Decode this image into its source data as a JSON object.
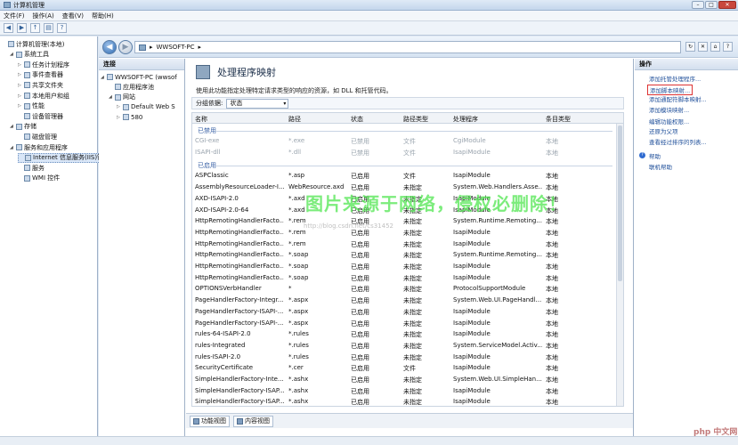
{
  "window": {
    "title": "计算机管理"
  },
  "menu": [
    "文件(F)",
    "操作(A)",
    "查看(V)",
    "帮助(H)"
  ],
  "tree": [
    {
      "label": "计算机管理(本地)",
      "ex": "",
      "indent": 0
    },
    {
      "label": "系统工具",
      "ex": "◢",
      "indent": 1
    },
    {
      "label": "任务计划程序",
      "ex": "▷",
      "indent": 2
    },
    {
      "label": "事件查看器",
      "ex": "▷",
      "indent": 2
    },
    {
      "label": "共享文件夹",
      "ex": "▷",
      "indent": 2
    },
    {
      "label": "本地用户和组",
      "ex": "▷",
      "indent": 2
    },
    {
      "label": "性能",
      "ex": "▷",
      "indent": 2
    },
    {
      "label": "设备管理器",
      "ex": "",
      "indent": 2
    },
    {
      "label": "存储",
      "ex": "◢",
      "indent": 1
    },
    {
      "label": "磁盘管理",
      "ex": "",
      "indent": 2
    },
    {
      "label": "服务和应用程序",
      "ex": "◢",
      "indent": 1
    },
    {
      "label": "Internet 信息服务(IIS)管",
      "ex": "",
      "indent": 2,
      "selected": true
    },
    {
      "label": "服务",
      "ex": "",
      "indent": 2
    },
    {
      "label": "WMI 控件",
      "ex": "",
      "indent": 2
    }
  ],
  "address": {
    "crumbs": [
      "▸",
      "WWSOFT-PC",
      "▸"
    ]
  },
  "connections": {
    "header": "连接",
    "items": [
      {
        "label": "WWSOFT-PC (wwsof",
        "ex": "◢",
        "indent": 0
      },
      {
        "label": "应用程序池",
        "ex": "",
        "indent": 1
      },
      {
        "label": "网站",
        "ex": "◢",
        "indent": 1
      },
      {
        "label": "Default Web S",
        "ex": "▷",
        "indent": 2
      },
      {
        "label": "580",
        "ex": "▷",
        "indent": 2
      }
    ]
  },
  "page": {
    "title": "处理程序映射",
    "description": "使用此功能指定处理特定请求类型的响应的资源，如 DLL 和托管代码。",
    "group_label": "分组依据:",
    "group_value": "状态"
  },
  "grid": {
    "columns": [
      "名称",
      "路径",
      "状态",
      "路径类型",
      "处理程序",
      "条目类型"
    ],
    "sections": [
      {
        "label": "已禁用",
        "disabled": true,
        "rows": [
          [
            "CGI-exe",
            "*.exe",
            "已禁用",
            "文件",
            "CgiModule",
            "本地"
          ],
          [
            "ISAPI-dll",
            "*.dll",
            "已禁用",
            "文件",
            "IsapiModule",
            "本地"
          ]
        ]
      },
      {
        "label": "已启用",
        "disabled": false,
        "rows": [
          [
            "ASPClassic",
            "*.asp",
            "已启用",
            "文件",
            "IsapiModule",
            "本地"
          ],
          [
            "AssemblyResourceLoader-I...",
            "WebResource.axd",
            "已启用",
            "未指定",
            "System.Web.Handlers.Asse...",
            "本地"
          ],
          [
            "AXD-ISAPI-2.0",
            "*.axd",
            "已启用",
            "未指定",
            "IsapiModule",
            "本地"
          ],
          [
            "AXD-ISAPI-2.0-64",
            "*.axd",
            "已启用",
            "未指定",
            "IsapiModule",
            "本地"
          ],
          [
            "HttpRemotingHandlerFacto...",
            "*.rem",
            "已启用",
            "未指定",
            "System.Runtime.Remoting....",
            "本地"
          ],
          [
            "HttpRemotingHandlerFacto...",
            "*.rem",
            "已启用",
            "未指定",
            "IsapiModule",
            "本地"
          ],
          [
            "HttpRemotingHandlerFacto...",
            "*.rem",
            "已启用",
            "未指定",
            "IsapiModule",
            "本地"
          ],
          [
            "HttpRemotingHandlerFacto...",
            "*.soap",
            "已启用",
            "未指定",
            "System.Runtime.Remoting....",
            "本地"
          ],
          [
            "HttpRemotingHandlerFacto...",
            "*.soap",
            "已启用",
            "未指定",
            "IsapiModule",
            "本地"
          ],
          [
            "HttpRemotingHandlerFacto...",
            "*.soap",
            "已启用",
            "未指定",
            "IsapiModule",
            "本地"
          ],
          [
            "OPTIONSVerbHandler",
            "*",
            "已启用",
            "未指定",
            "ProtocolSupportModule",
            "本地"
          ],
          [
            "PageHandlerFactory-Integr...",
            "*.aspx",
            "已启用",
            "未指定",
            "System.Web.UI.PageHandl...",
            "本地"
          ],
          [
            "PageHandlerFactory-ISAPI-...",
            "*.aspx",
            "已启用",
            "未指定",
            "IsapiModule",
            "本地"
          ],
          [
            "PageHandlerFactory-ISAPI-...",
            "*.aspx",
            "已启用",
            "未指定",
            "IsapiModule",
            "本地"
          ],
          [
            "rules-64-ISAPI-2.0",
            "*.rules",
            "已启用",
            "未指定",
            "IsapiModule",
            "本地"
          ],
          [
            "rules-Integrated",
            "*.rules",
            "已启用",
            "未指定",
            "System.ServiceModel.Activ...",
            "本地"
          ],
          [
            "rules-ISAPI-2.0",
            "*.rules",
            "已启用",
            "未指定",
            "IsapiModule",
            "本地"
          ],
          [
            "SecurityCertificate",
            "*.cer",
            "已启用",
            "文件",
            "IsapiModule",
            "本地"
          ],
          [
            "SimpleHandlerFactory-Inte...",
            "*.ashx",
            "已启用",
            "未指定",
            "System.Web.UI.SimpleHan...",
            "本地"
          ],
          [
            "SimpleHandlerFactory-ISAP...",
            "*.ashx",
            "已启用",
            "未指定",
            "IsapiModule",
            "本地"
          ],
          [
            "SimpleHandlerFactory-ISAP...",
            "*.ashx",
            "已启用",
            "未指定",
            "IsapiModule",
            "本地"
          ]
        ]
      }
    ]
  },
  "view_tabs": [
    "功能视图",
    "内容视图"
  ],
  "actions": {
    "header": "操作",
    "items": [
      {
        "label": "添加托管处理程序...",
        "highlight": false
      },
      {
        "label": "添加脚本映射...",
        "highlight": true
      },
      {
        "label": "添加通配符脚本映射...",
        "highlight": false
      },
      {
        "label": "添加模块映射...",
        "highlight": false
      },
      {
        "label": "编辑功能权限...",
        "highlight": false
      },
      {
        "label": "还原为父项",
        "highlight": false
      },
      {
        "label": "查看经过排序的列表...",
        "highlight": false
      }
    ],
    "help": [
      "帮助",
      "联机帮助"
    ]
  },
  "watermark": {
    "text": "图片来源于网络，侵权必删除！",
    "url": "http://blog.csdn.net/cs31452",
    "site": "php 中文网"
  }
}
